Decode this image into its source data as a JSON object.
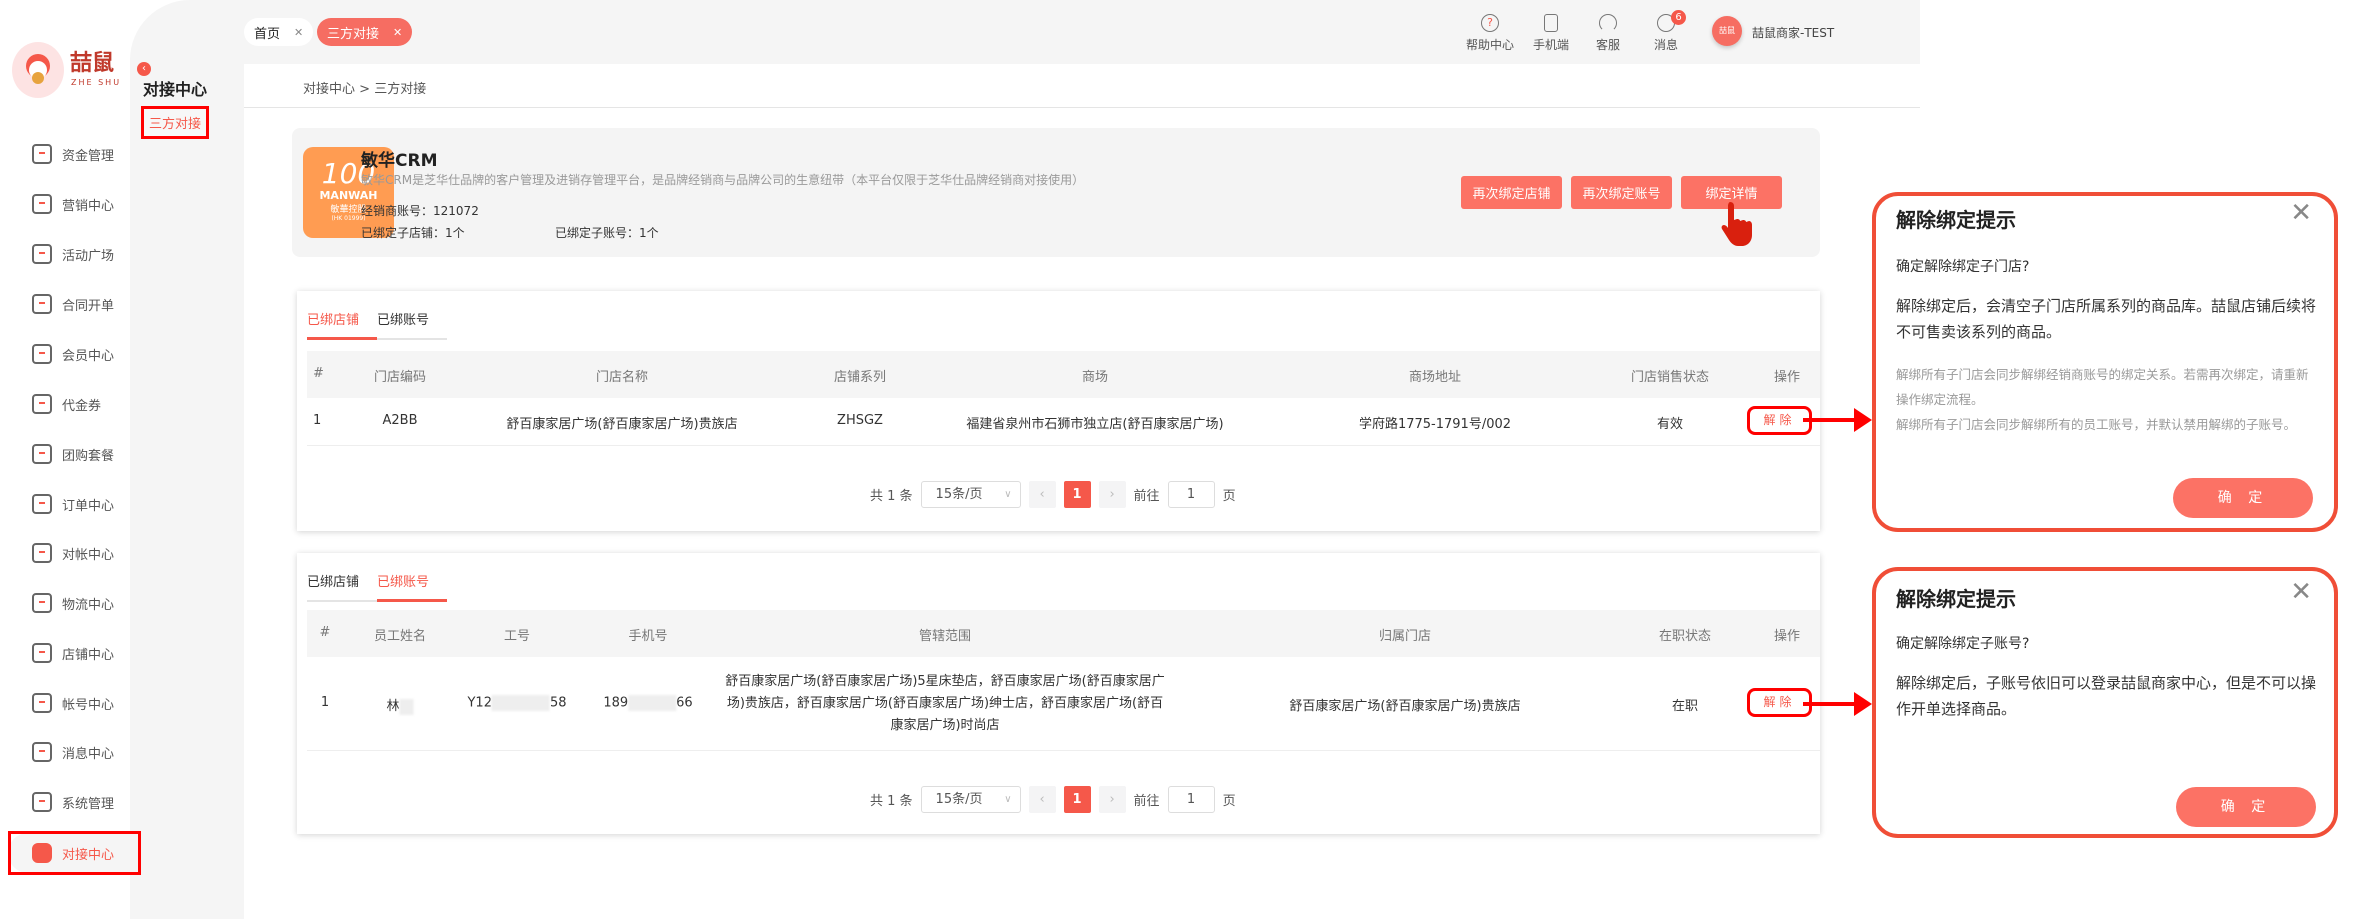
{
  "brand": {
    "name": "喆鼠",
    "sub": "ZHE SHU"
  },
  "sidebar": {
    "items": [
      {
        "label": "资金管理",
        "icon": "layers-icon"
      },
      {
        "label": "营销中心",
        "icon": "marketing-icon"
      },
      {
        "label": "活动广场",
        "icon": "box-icon"
      },
      {
        "label": "合同开单",
        "icon": "contract-icon"
      },
      {
        "label": "会员中心",
        "icon": "vip-icon"
      },
      {
        "label": "代金券",
        "icon": "coupon-icon"
      },
      {
        "label": "团购套餐",
        "icon": "tag-icon"
      },
      {
        "label": "订单中心",
        "icon": "order-icon"
      },
      {
        "label": "对帐中心",
        "icon": "yen-icon"
      },
      {
        "label": "物流中心",
        "icon": "package-icon"
      },
      {
        "label": "店铺中心",
        "icon": "store-icon"
      },
      {
        "label": "帐号中心",
        "icon": "user-icon"
      },
      {
        "label": "消息中心",
        "icon": "chat-icon"
      },
      {
        "label": "系统管理",
        "icon": "settings-icon"
      },
      {
        "label": "对接中心",
        "icon": "connect-icon",
        "active": true
      }
    ]
  },
  "submenu": {
    "title": "对接中心",
    "item": "三方对接"
  },
  "tabs": [
    {
      "label": "首页"
    },
    {
      "label": "三方对接",
      "active": true
    }
  ],
  "header": {
    "help": "帮助中心",
    "mobile": "手机端",
    "service": "客服",
    "messages": "消息",
    "message_count": "6",
    "user": "喆鼠商家-TEST",
    "avatar_text": "喆鼠"
  },
  "breadcrumb": {
    "parent": "对接中心",
    "sep": ">",
    "current": "三方对接"
  },
  "info": {
    "title": "敏华CRM",
    "desc": "敏华CRM是芝华仕品牌的客户管理及进销存管理平台，是品牌经销商与品牌公司的生意纽带（本平台仅限于芝华仕品牌经销商对接使用）",
    "dealer_label": "经销商账号：",
    "dealer": "121072",
    "stores_label": "已绑定子店铺：",
    "stores": "1个",
    "accounts_label": "已绑定子账号：",
    "accounts": "1个",
    "logo": {
      "brand": "MANWAH",
      "cn": "敏華控股",
      "code": "(HK 01999)"
    },
    "buttons": {
      "rebind_store": "再次绑定店铺",
      "rebind_account": "再次绑定账号",
      "details": "绑定详情"
    }
  },
  "stores_table": {
    "tabs": [
      "已绑店铺",
      "已绑账号"
    ],
    "active_tab": 0,
    "columns": [
      "#",
      "门店编码",
      "门店名称",
      "店铺系列",
      "商场",
      "商场地址",
      "门店销售状态",
      "操作"
    ],
    "rows": [
      {
        "no": "1",
        "code": "A2BB",
        "name": "舒百康家居广场(舒百康家居广场)贵族店",
        "series": "ZHSGZ",
        "mall": "福建省泉州市石狮市独立店(舒百康家居广场)",
        "address": "学府路1775-1791号/002",
        "status": "有效",
        "action": "解除"
      }
    ],
    "pager": {
      "total": "共 1 条",
      "size": "15条/页",
      "page": "1",
      "goto": "前往",
      "goto_value": "1",
      "page_suffix": "页"
    }
  },
  "accounts_table": {
    "tabs": [
      "已绑店铺",
      "已绑账号"
    ],
    "active_tab": 1,
    "columns": [
      "#",
      "员工姓名",
      "工号",
      "手机号",
      "管辖范围",
      "归属门店",
      "在职状态",
      "操作"
    ],
    "rows": [
      {
        "no": "1",
        "name": "林",
        "id_prefix": "Y12",
        "id_suffix": "58",
        "phone_prefix": "189",
        "phone_suffix": "66",
        "scope": "舒百康家居广场(舒百康家居广场)5星床垫店，舒百康家居广场(舒百康家居广场)贵族店，舒百康家居广场(舒百康家居广场)绅士店，舒百康家居广场(舒百康家居广场)时尚店",
        "store": "舒百康家居广场(舒百康家居广场)贵族店",
        "status": "在职",
        "action": "解除"
      }
    ],
    "pager": {
      "total": "共 1 条",
      "size": "15条/页",
      "page": "1",
      "goto": "前往",
      "goto_value": "1",
      "page_suffix": "页"
    }
  },
  "dialog_store": {
    "title": "解除绑定提示",
    "question": "确定解除绑定子门店?",
    "body": "解除绑定后，会清空子门店所属系列的商品库。喆鼠店铺后续将不可售卖该系列的商品。",
    "note1": "解绑所有子门店会同步解绑经销商账号的绑定关系。若需再次绑定，请重新操作绑定流程。",
    "note2": "解绑所有子门店会同步解绑所有的员工账号，并默认禁用解绑的子账号。",
    "confirm": "确 定"
  },
  "dialog_account": {
    "title": "解除绑定提示",
    "question": "确定解除绑定子账号?",
    "body": "解除绑定后，子账号依旧可以登录喆鼠商家中心，但是不可以操作开单选择商品。",
    "confirm": "确 定"
  },
  "colors": {
    "accent": "#f5584a",
    "button": "#fc7265",
    "annotation": "#ff0000",
    "logo_bg": "#ff9c52"
  }
}
